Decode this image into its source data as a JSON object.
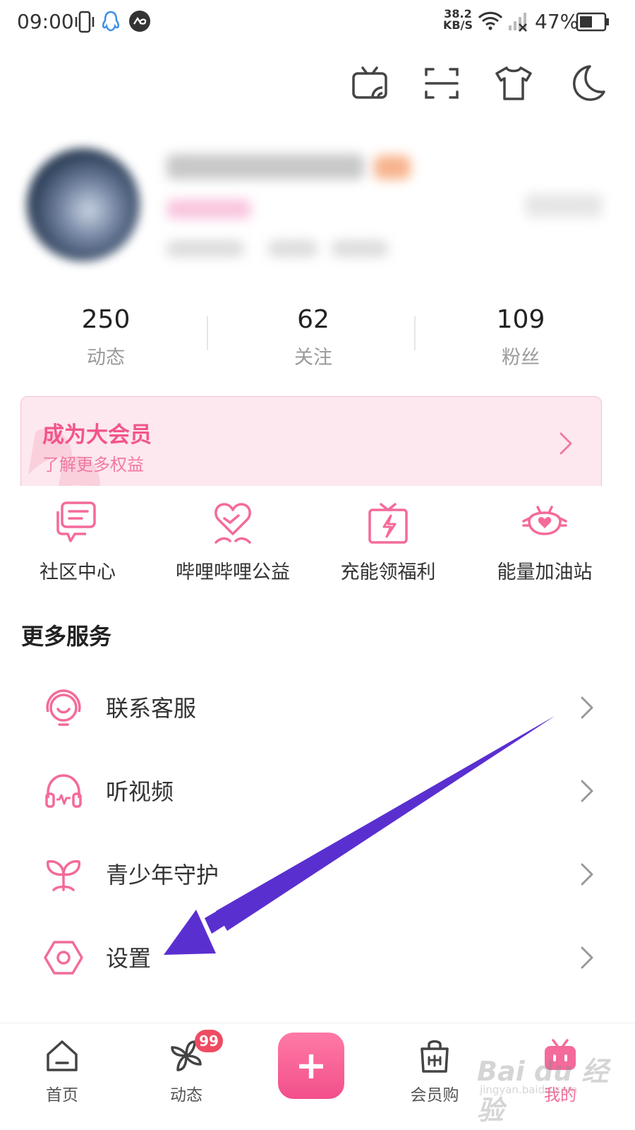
{
  "status_bar": {
    "time": "09:00",
    "net_speed_value": "38.2",
    "net_speed_unit": "KB/S",
    "battery": "47%"
  },
  "top_icons": [
    "tv-cast-icon",
    "scan-icon",
    "tshirt-icon",
    "moon-icon"
  ],
  "stats": [
    {
      "value": "250",
      "label": "动态"
    },
    {
      "value": "62",
      "label": "关注"
    },
    {
      "value": "109",
      "label": "粉丝"
    }
  ],
  "vip": {
    "title": "成为大会员",
    "subtitle": "了解更多权益"
  },
  "grid": [
    {
      "label": "社区中心",
      "icon": "community-chat-icon"
    },
    {
      "label": "哔哩哔哩公益",
      "icon": "heart-charity-icon"
    },
    {
      "label": "充能领福利",
      "icon": "gift-energy-icon"
    },
    {
      "label": "能量加油站",
      "icon": "energy-station-icon"
    }
  ],
  "more_services": {
    "title": "更多服务",
    "items": [
      {
        "label": "联系客服",
        "icon": "customer-service-icon"
      },
      {
        "label": "听视频",
        "icon": "headphones-icon"
      },
      {
        "label": "青少年守护",
        "icon": "sprout-icon"
      },
      {
        "label": "设置",
        "icon": "settings-hexagon-icon"
      }
    ]
  },
  "bottom_nav": {
    "items": [
      {
        "label": "首页",
        "icon": "home-icon"
      },
      {
        "label": "动态",
        "icon": "pinwheel-icon"
      },
      {
        "label": "会员购",
        "icon": "shopping-bag-icon"
      },
      {
        "label": "我的",
        "icon": "tv-mascot-icon"
      }
    ],
    "badge": "99",
    "active": "我的"
  },
  "colors": {
    "accent": "#f46a9b",
    "vip_title": "#f2558b",
    "arrow": "#5a2fd0"
  },
  "watermark": {
    "main": "Bai du 经验",
    "sub": "jingyan.baidu.com"
  }
}
